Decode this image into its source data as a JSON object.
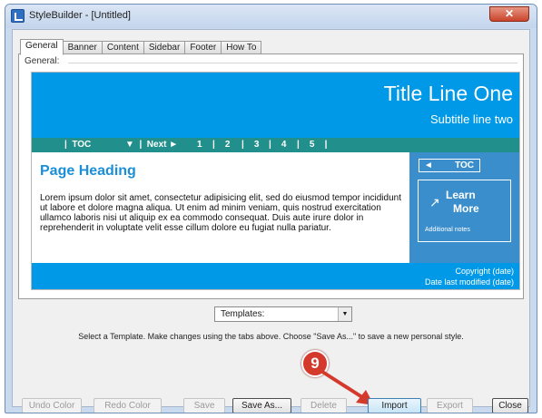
{
  "window": {
    "title": "StyleBuilder - [Untitled]",
    "close_symbol": "✕"
  },
  "tabs": [
    {
      "label": "General",
      "active": true
    },
    {
      "label": "Banner"
    },
    {
      "label": "Content"
    },
    {
      "label": "Sidebar"
    },
    {
      "label": "Footer"
    },
    {
      "label": "How To"
    }
  ],
  "general_group_label": "General:",
  "preview": {
    "title": "Title Line One",
    "subtitle": "Subtitle line two",
    "nav": {
      "toc": "|  TOC",
      "next": "▼  |  Next ►",
      "page_1": "1",
      "page_2": "|    2",
      "page_3": "|    3",
      "page_4": "|    4",
      "page_5": "|    5    |"
    },
    "page_heading": "Page Heading",
    "body_text": "Lorem ipsum dolor sit amet, consectetur adipisicing elit, sed do eiusmod tempor incididunt ut labore et dolore magna aliqua. Ut enim ad minim veniam, quis nostrud exercitation ullamco laboris nisi ut aliquip ex ea commodo consequat. Duis aute irure dolor in reprehenderit in voluptate velit esse cillum dolore eu fugiat nulla pariatur.",
    "sidebar": {
      "toc_arrow": "◄",
      "toc_label": "TOC",
      "learn_line1": "Learn",
      "learn_line2": "More",
      "learn_icon": "↗",
      "notes": "Additional notes"
    },
    "footer": {
      "copyright": "Copyright (date)",
      "date_modified": "Date last modified (date)"
    },
    "colors": {
      "banner_blue": "#0099e8",
      "nav_teal": "#21908c",
      "sidebar_blue": "#3b8ecc",
      "heading_blue": "#1a8fd8"
    }
  },
  "templates": {
    "selected": "Templates:",
    "dropdown_icon": "▼"
  },
  "hint_text": "Select a Template. Make changes using the tabs above. Choose \"Save As...\" to save a new personal style.",
  "callout": {
    "number": "9",
    "color": "#d33a2c"
  },
  "buttons": {
    "undo_color": "Undo Color",
    "redo_color": "Redo Color",
    "save": "Save",
    "save_as": "Save As...",
    "delete": "Delete",
    "import": "Import",
    "export": "Export",
    "close": "Close"
  }
}
